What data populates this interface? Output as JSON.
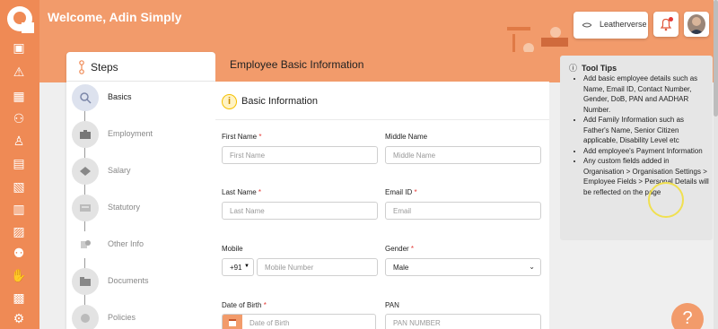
{
  "header": {
    "welcome": "Welcome, Adin Simply",
    "brand": "Leatherverse"
  },
  "rail": {
    "icons": [
      "dashboard-icon",
      "alert-icon",
      "building-icon",
      "users-icon",
      "org-chart-icon",
      "calendar-icon",
      "document-icon",
      "money-icon",
      "chart-icon",
      "people-icon",
      "hand-icon",
      "payroll-icon",
      "settings-icon"
    ]
  },
  "steps": {
    "title": "Steps",
    "items": [
      {
        "label": "Basics",
        "icon": "magnifier-icon"
      },
      {
        "label": "Employment",
        "icon": "briefcase-icon"
      },
      {
        "label": "Salary",
        "icon": "money-icon"
      },
      {
        "label": "Statutory",
        "icon": "document-icon"
      },
      {
        "label": "Other Info",
        "icon": "info-icon"
      },
      {
        "label": "Documents",
        "icon": "folder-icon"
      },
      {
        "label": "Policies",
        "icon": "policy-icon"
      }
    ]
  },
  "form": {
    "title": "Employee Basic Information",
    "section": "Basic Information",
    "fields": {
      "first_name": {
        "label": "First Name",
        "placeholder": "First Name"
      },
      "middle_name": {
        "label": "Middle Name",
        "placeholder": "Middle Name"
      },
      "last_name": {
        "label": "Last Name",
        "placeholder": "Last Name"
      },
      "email": {
        "label": "Email ID",
        "placeholder": "Email"
      },
      "mobile": {
        "label": "Mobile",
        "placeholder": "Mobile Number",
        "country_code": "+91"
      },
      "gender": {
        "label": "Gender",
        "value": "Male"
      },
      "dob": {
        "label": "Date of Birth",
        "placeholder": "Date of Birth"
      },
      "pan": {
        "label": "PAN",
        "placeholder": "PAN NUMBER"
      }
    }
  },
  "tips": {
    "title": "Tool Tips",
    "items": [
      "Add basic employee details such as Name, Email ID, Contact Number, Gender, DoB, PAN and AADHAR Number.",
      "Add Family Information such as Father's Name, Senior Citizen applicable, Disability Level etc",
      "Add employee's Payment Information",
      "Any custom fields added in Organisation > Organisation Settings > Employee Fields > Personal Details will be reflected on the page"
    ]
  },
  "help": "?",
  "colors": {
    "accent": "#f29b6b",
    "rail": "#ef8a55",
    "required": "#e53935"
  }
}
